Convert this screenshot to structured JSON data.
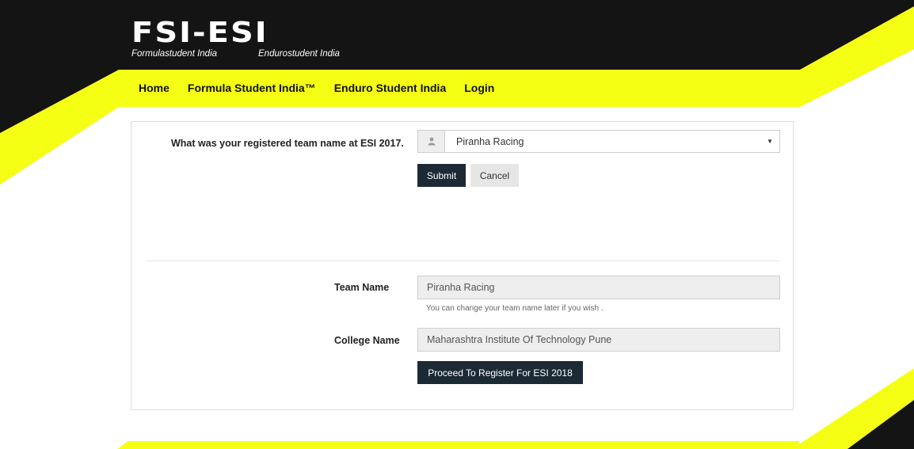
{
  "logo": {
    "text": "FSI-ESI",
    "subtitle_left": "Formulastudent India",
    "subtitle_right": "Endurostudent India"
  },
  "nav": {
    "items": [
      {
        "label": "Home"
      },
      {
        "label": "Formula Student India™"
      },
      {
        "label": "Enduro Student India"
      },
      {
        "label": "Login"
      }
    ]
  },
  "form": {
    "question_label": "What was your registered team name at ESI 2017.",
    "team_select_value": "Piranha Racing",
    "submit_label": "Submit",
    "cancel_label": "Cancel",
    "team_name_label": "Team Name",
    "team_name_value": "Piranha Racing",
    "team_name_help": "You can change your team name later if you wish .",
    "college_name_label": "College Name",
    "college_name_value": "Maharashtra Institute Of  Technology Pune",
    "proceed_label": "Proceed To Register For ESI 2018"
  },
  "colors": {
    "accent_yellow": "#f5ff14",
    "header_black": "#141414",
    "button_dark": "#1c2a36"
  },
  "icons": {
    "select_addon": "user-icon",
    "select_caret": "caret-down-icon"
  }
}
